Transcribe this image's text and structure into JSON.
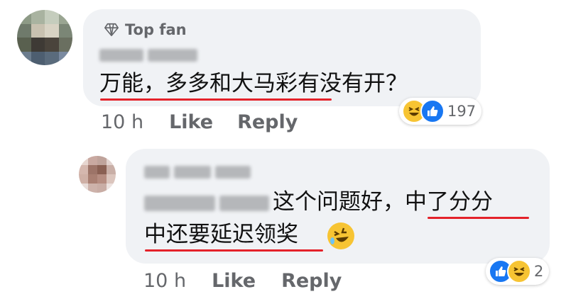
{
  "comment": {
    "badge_label": "Top fan",
    "text": "万能，多多和大马彩有没有开？",
    "time": "10 h",
    "like_label": "Like",
    "reply_label": "Reply",
    "reactions": {
      "icons": [
        "haha",
        "like"
      ],
      "count": "197"
    }
  },
  "reply": {
    "text_line1": "这个问题好，中了分分",
    "text_line2": "中还要延迟领奖",
    "time": "10 h",
    "like_label": "Like",
    "reply_label": "Reply",
    "reactions": {
      "icons": [
        "like",
        "haha"
      ],
      "count": "2"
    }
  },
  "colors": {
    "bubble": "#f0f2f5",
    "underline": "#e4222a",
    "meta_text": "#65676b",
    "like_blue": "#1877f2",
    "haha_yellow": "#f7c433"
  }
}
